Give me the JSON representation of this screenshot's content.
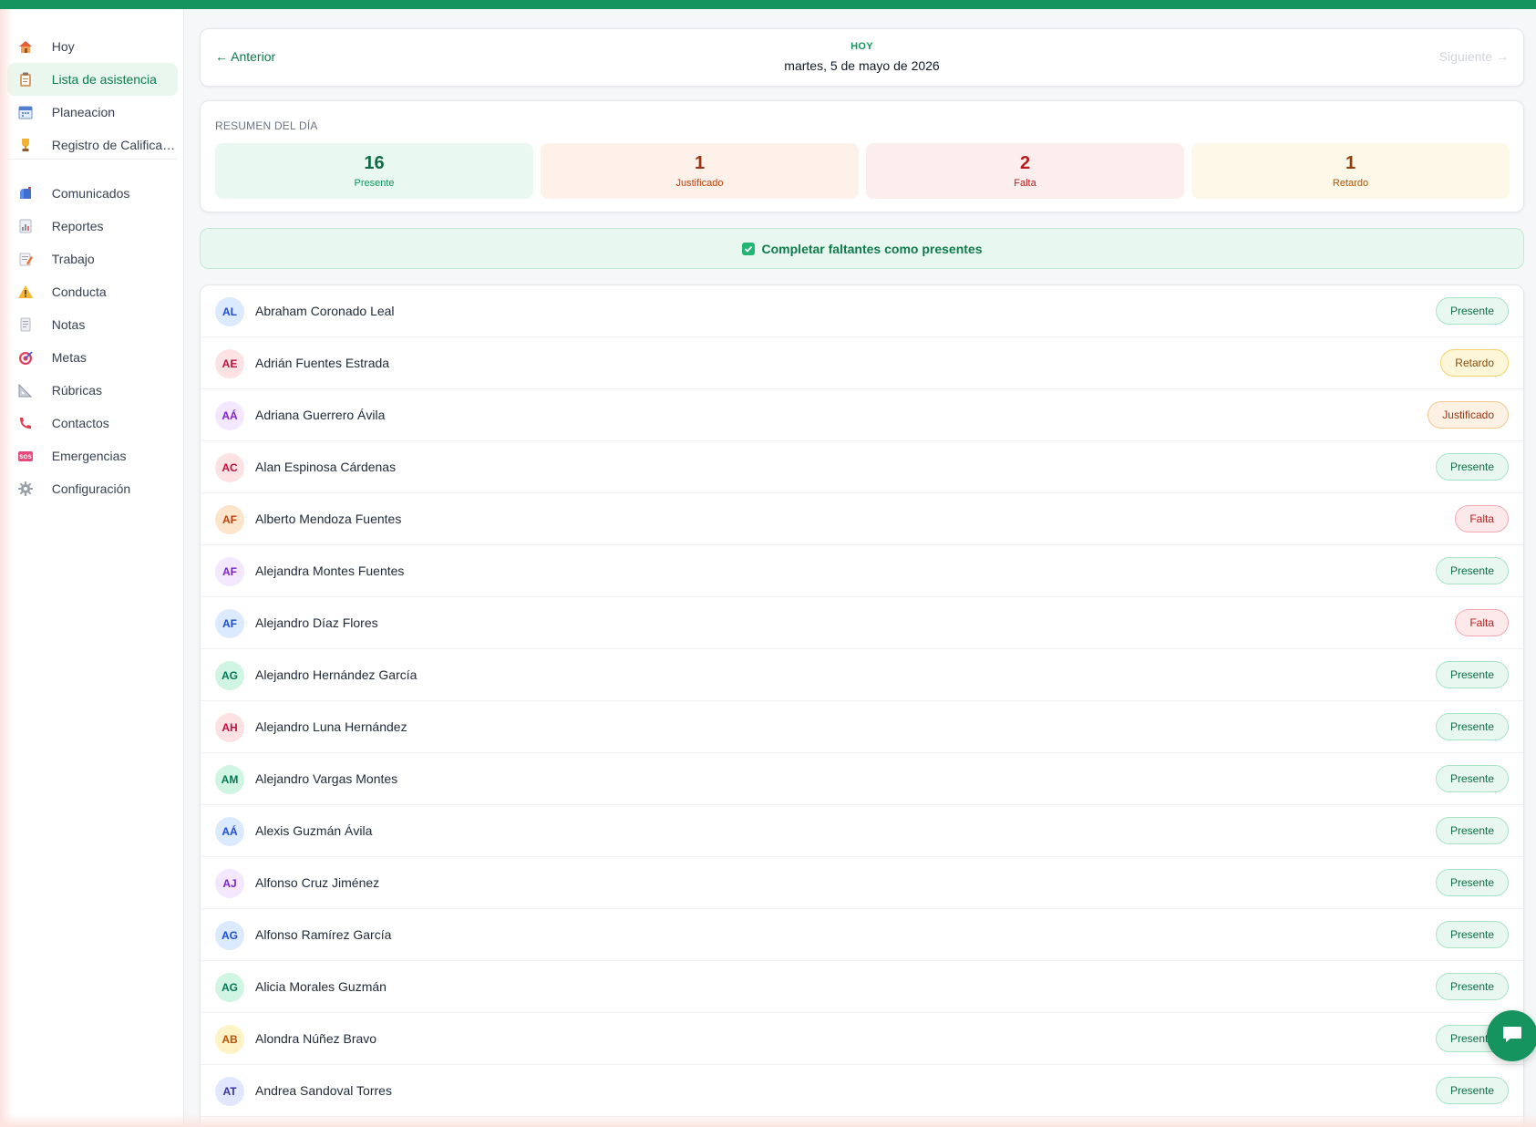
{
  "sidebar": {
    "items": [
      {
        "label": "Hoy",
        "icon": "home-icon"
      },
      {
        "label": "Lista de asistencia",
        "icon": "clipboard-icon",
        "active": true
      },
      {
        "label": "Planeacion",
        "icon": "calendar-icon"
      },
      {
        "label": "Registro de Calificaciones",
        "icon": "trophy-icon"
      },
      {
        "label": "Comunicados",
        "icon": "mailbox-icon"
      },
      {
        "label": "Reportes",
        "icon": "report-icon"
      },
      {
        "label": "Trabajo",
        "icon": "memo-icon"
      },
      {
        "label": "Conducta",
        "icon": "warning-icon"
      },
      {
        "label": "Notas",
        "icon": "notepad-icon"
      },
      {
        "label": "Metas",
        "icon": "target-icon"
      },
      {
        "label": "Rúbricas",
        "icon": "ruler-icon"
      },
      {
        "label": "Contactos",
        "icon": "phone-icon"
      },
      {
        "label": "Emergencias",
        "icon": "sos-icon"
      },
      {
        "label": "Configuración",
        "icon": "gear-icon"
      }
    ]
  },
  "datebar": {
    "prev": "← Anterior",
    "next": "Siguiente →",
    "tag": "HOY",
    "date": "martes, 5 de mayo de 2026"
  },
  "summary": {
    "title": "RESUMEN DEL DÍA",
    "present": {
      "value": "16",
      "label": "Presente"
    },
    "justified": {
      "value": "1",
      "label": "Justificado"
    },
    "absent": {
      "value": "2",
      "label": "Falta"
    },
    "late": {
      "value": "1",
      "label": "Retardo"
    }
  },
  "complete_button": "Completar faltantes como presentes",
  "students": [
    {
      "initials": "AL",
      "name": "Abraham Coronado Leal",
      "status": "Presente",
      "status_class": "presente",
      "avatar_bg": "#dbeafe",
      "avatar_fg": "#1d4ed8"
    },
    {
      "initials": "AE",
      "name": "Adrián Fuentes Estrada",
      "status": "Retardo",
      "status_class": "retardo",
      "avatar_bg": "#fde2e4",
      "avatar_fg": "#be123c"
    },
    {
      "initials": "AÁ",
      "name": "Adriana Guerrero Ávila",
      "status": "Justificado",
      "status_class": "justificado",
      "avatar_bg": "#f3e8ff",
      "avatar_fg": "#7e22ce"
    },
    {
      "initials": "AC",
      "name": "Alan Espinosa Cárdenas",
      "status": "Presente",
      "status_class": "presente",
      "avatar_bg": "#fde2e4",
      "avatar_fg": "#be123c"
    },
    {
      "initials": "AF",
      "name": "Alberto Mendoza Fuentes",
      "status": "Falta",
      "status_class": "falta",
      "avatar_bg": "#fde5cc",
      "avatar_fg": "#c2410c"
    },
    {
      "initials": "AF",
      "name": "Alejandra Montes Fuentes",
      "status": "Presente",
      "status_class": "presente",
      "avatar_bg": "#f3e8ff",
      "avatar_fg": "#7e22ce"
    },
    {
      "initials": "AF",
      "name": "Alejandro Díaz Flores",
      "status": "Falta",
      "status_class": "falta",
      "avatar_bg": "#dbeafe",
      "avatar_fg": "#1d4ed8"
    },
    {
      "initials": "AG",
      "name": "Alejandro Hernández García",
      "status": "Presente",
      "status_class": "presente",
      "avatar_bg": "#d1f5e3",
      "avatar_fg": "#047857"
    },
    {
      "initials": "AH",
      "name": "Alejandro Luna Hernández",
      "status": "Presente",
      "status_class": "presente",
      "avatar_bg": "#fde2e4",
      "avatar_fg": "#be123c"
    },
    {
      "initials": "AM",
      "name": "Alejandro Vargas Montes",
      "status": "Presente",
      "status_class": "presente",
      "avatar_bg": "#d1f5e3",
      "avatar_fg": "#047857"
    },
    {
      "initials": "AÁ",
      "name": "Alexis Guzmán Ávila",
      "status": "Presente",
      "status_class": "presente",
      "avatar_bg": "#dbeafe",
      "avatar_fg": "#1d4ed8"
    },
    {
      "initials": "AJ",
      "name": "Alfonso Cruz Jiménez",
      "status": "Presente",
      "status_class": "presente",
      "avatar_bg": "#f3e8ff",
      "avatar_fg": "#7e22ce"
    },
    {
      "initials": "AG",
      "name": "Alfonso Ramírez García",
      "status": "Presente",
      "status_class": "presente",
      "avatar_bg": "#dbeafe",
      "avatar_fg": "#1d4ed8"
    },
    {
      "initials": "AG",
      "name": "Alicia Morales Guzmán",
      "status": "Presente",
      "status_class": "presente",
      "avatar_bg": "#d1f5e3",
      "avatar_fg": "#047857"
    },
    {
      "initials": "AB",
      "name": "Alondra Núñez Bravo",
      "status": "Presente",
      "status_class": "presente",
      "avatar_bg": "#fef3c7",
      "avatar_fg": "#b45309"
    },
    {
      "initials": "AT",
      "name": "Andrea Sandoval Torres",
      "status": "Presente",
      "status_class": "presente",
      "avatar_bg": "#e0e7ff",
      "avatar_fg": "#3730a3"
    }
  ]
}
